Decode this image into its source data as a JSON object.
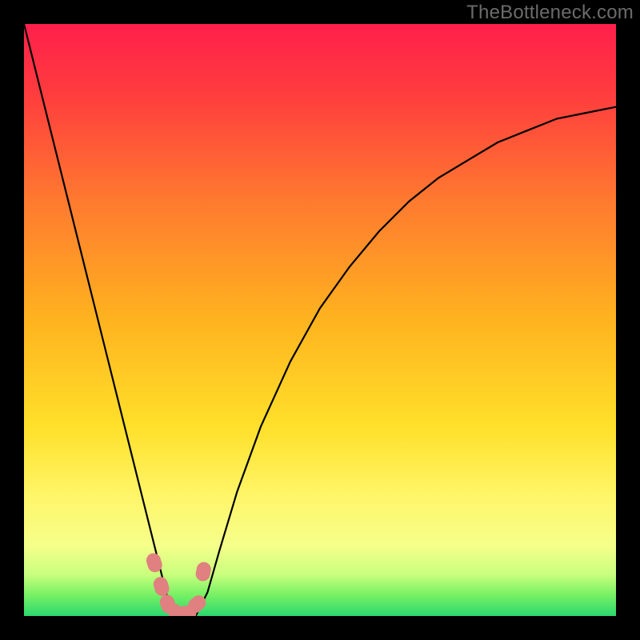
{
  "watermark": "TheBottleneck.com",
  "chart_data": {
    "type": "line",
    "title": "",
    "xlabel": "",
    "ylabel": "",
    "xlim": [
      0,
      100
    ],
    "ylim": [
      0,
      100
    ],
    "grid": false,
    "curve": {
      "x": [
        0,
        3,
        6,
        9,
        12,
        15,
        18,
        21,
        24,
        25,
        27,
        29,
        31,
        33,
        36,
        40,
        45,
        50,
        55,
        60,
        65,
        70,
        75,
        80,
        85,
        90,
        95,
        100
      ],
      "y": [
        100,
        88,
        76,
        64,
        52,
        40,
        28,
        16,
        4,
        0,
        0,
        0,
        4,
        11,
        21,
        32,
        43,
        52,
        59,
        65,
        70,
        74,
        77,
        80,
        82,
        84,
        85,
        86
      ]
    },
    "markers": {
      "x": [
        22.0,
        23.2,
        24.3,
        25.8,
        27.5,
        29.2,
        30.3
      ],
      "y": [
        9.0,
        5.0,
        2.0,
        0.5,
        0.5,
        2.0,
        7.5
      ]
    },
    "gradient_stops": [
      {
        "offset": 0.0,
        "color": "#ff1f4b"
      },
      {
        "offset": 0.12,
        "color": "#ff3d3e"
      },
      {
        "offset": 0.3,
        "color": "#ff7a2f"
      },
      {
        "offset": 0.5,
        "color": "#ffb31f"
      },
      {
        "offset": 0.68,
        "color": "#ffe02a"
      },
      {
        "offset": 0.8,
        "color": "#fff66a"
      },
      {
        "offset": 0.88,
        "color": "#f6ff8a"
      },
      {
        "offset": 0.93,
        "color": "#c9ff7d"
      },
      {
        "offset": 0.965,
        "color": "#76f064"
      },
      {
        "offset": 1.0,
        "color": "#2bd86f"
      }
    ],
    "curve_color": "#000000",
    "marker_color": "#e08080",
    "marker_radius_px": 12
  }
}
